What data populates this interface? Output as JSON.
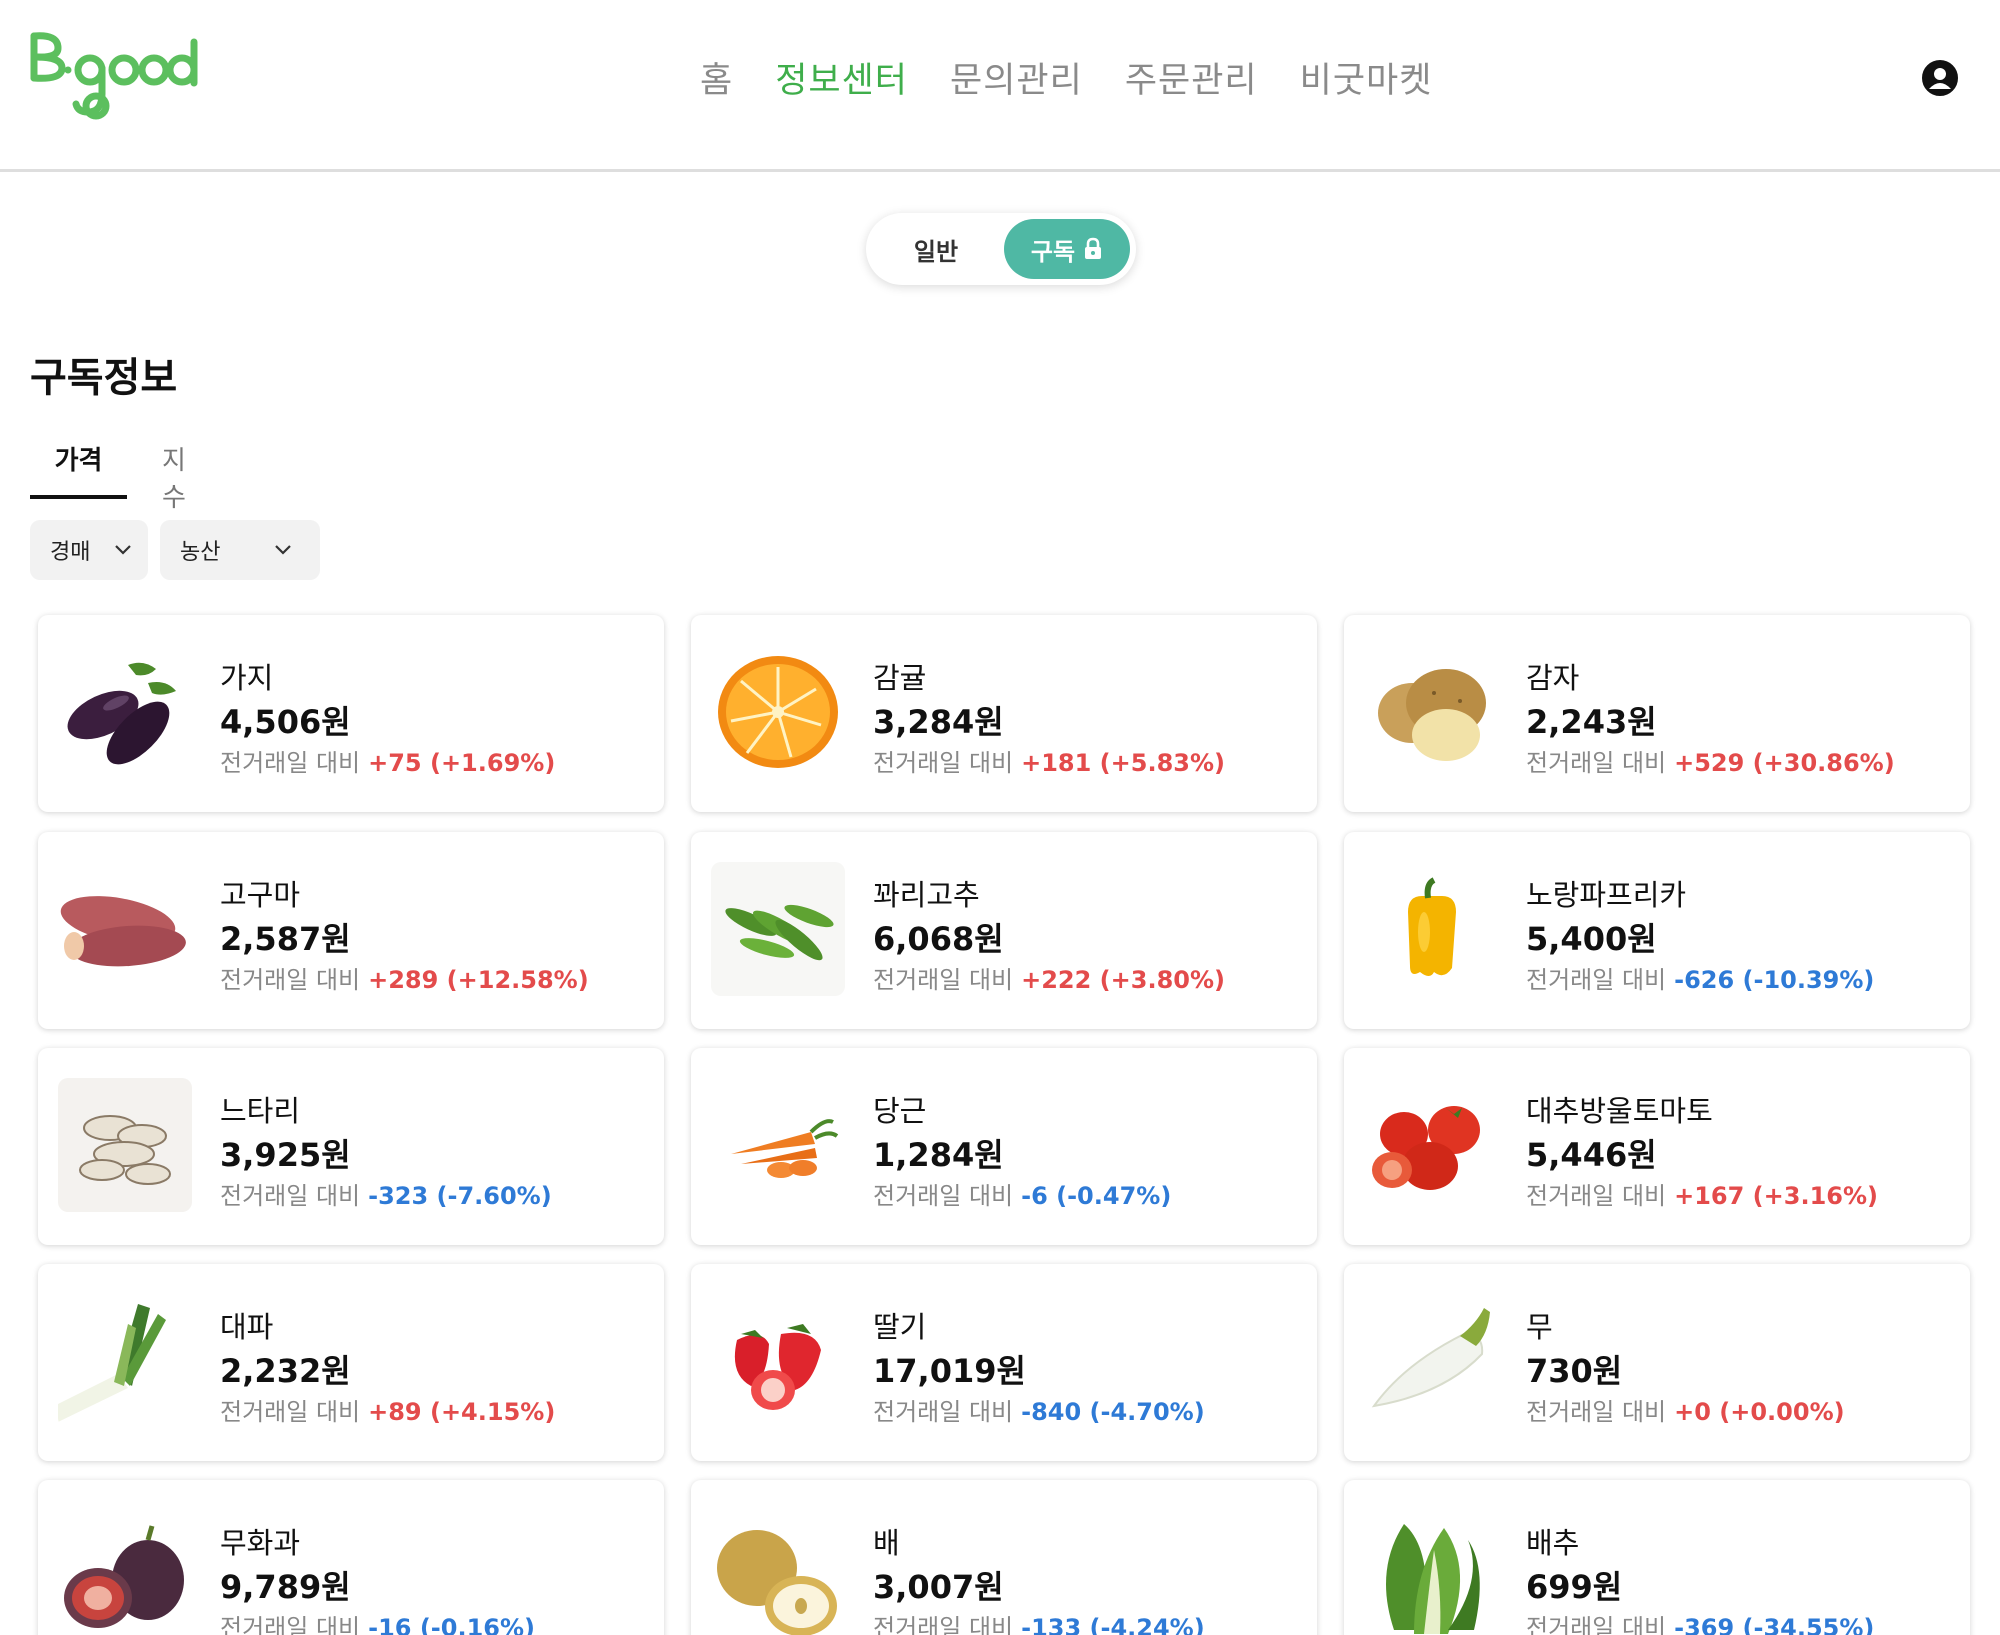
{
  "header": {
    "logo_text": "B-good",
    "nav": [
      {
        "label": "홈",
        "active": false
      },
      {
        "label": "정보센터",
        "active": true
      },
      {
        "label": "문의관리",
        "active": false
      },
      {
        "label": "주문관리",
        "active": false
      },
      {
        "label": "비굿마켓",
        "active": false
      }
    ],
    "profile_icon": "user-circle-icon"
  },
  "toggle": {
    "general_label": "일반",
    "subscription_label": "구독",
    "subscription_icon": "lock-icon",
    "accent": "#4fb8a4"
  },
  "section": {
    "title": "구독정보",
    "tabs": [
      {
        "label": "가격",
        "active": true
      },
      {
        "label": "지수",
        "active": false
      }
    ],
    "filters": {
      "market": "경매",
      "category": "농산"
    }
  },
  "colors": {
    "brand": "#3fae4b",
    "increase": "#e34b4b",
    "decrease": "#2e7ad6"
  },
  "change_label": "전거래일 대비",
  "items": [
    {
      "name": "가지",
      "price": "4,506원",
      "delta": "+75 (+1.69%)",
      "direction": "up",
      "image": "eggplant-image"
    },
    {
      "name": "감귤",
      "price": "3,284원",
      "delta": "+181 (+5.83%)",
      "direction": "up",
      "image": "tangerine-image"
    },
    {
      "name": "감자",
      "price": "2,243원",
      "delta": "+529 (+30.86%)",
      "direction": "up",
      "image": "potato-image"
    },
    {
      "name": "고구마",
      "price": "2,587원",
      "delta": "+289 (+12.58%)",
      "direction": "up",
      "image": "sweet-potato-image"
    },
    {
      "name": "꽈리고추",
      "price": "6,068원",
      "delta": "+222 (+3.80%)",
      "direction": "up",
      "image": "shishito-pepper-image"
    },
    {
      "name": "노랑파프리카",
      "price": "5,400원",
      "delta": "-626 (-10.39%)",
      "direction": "down",
      "image": "yellow-paprika-image"
    },
    {
      "name": "느타리",
      "price": "3,925원",
      "delta": "-323 (-7.60%)",
      "direction": "down",
      "image": "oyster-mushroom-image"
    },
    {
      "name": "당근",
      "price": "1,284원",
      "delta": "-6 (-0.47%)",
      "direction": "down",
      "image": "carrot-image"
    },
    {
      "name": "대추방울토마토",
      "price": "5,446원",
      "delta": "+167 (+3.16%)",
      "direction": "up",
      "image": "cherry-tomato-image"
    },
    {
      "name": "대파",
      "price": "2,232원",
      "delta": "+89 (+4.15%)",
      "direction": "up",
      "image": "green-onion-image"
    },
    {
      "name": "딸기",
      "price": "17,019원",
      "delta": "-840 (-4.70%)",
      "direction": "down",
      "image": "strawberry-image"
    },
    {
      "name": "무",
      "price": "730원",
      "delta": "+0 (+0.00%)",
      "direction": "flat",
      "image": "radish-image"
    },
    {
      "name": "무화과",
      "price": "9,789원",
      "delta": "-16 (-0.16%)",
      "direction": "down",
      "image": "fig-image"
    },
    {
      "name": "배",
      "price": "3,007원",
      "delta": "-133 (-4.24%)",
      "direction": "down",
      "image": "pear-image"
    },
    {
      "name": "배추",
      "price": "699원",
      "delta": "-369 (-34.55%)",
      "direction": "down",
      "image": "napa-cabbage-image"
    }
  ]
}
